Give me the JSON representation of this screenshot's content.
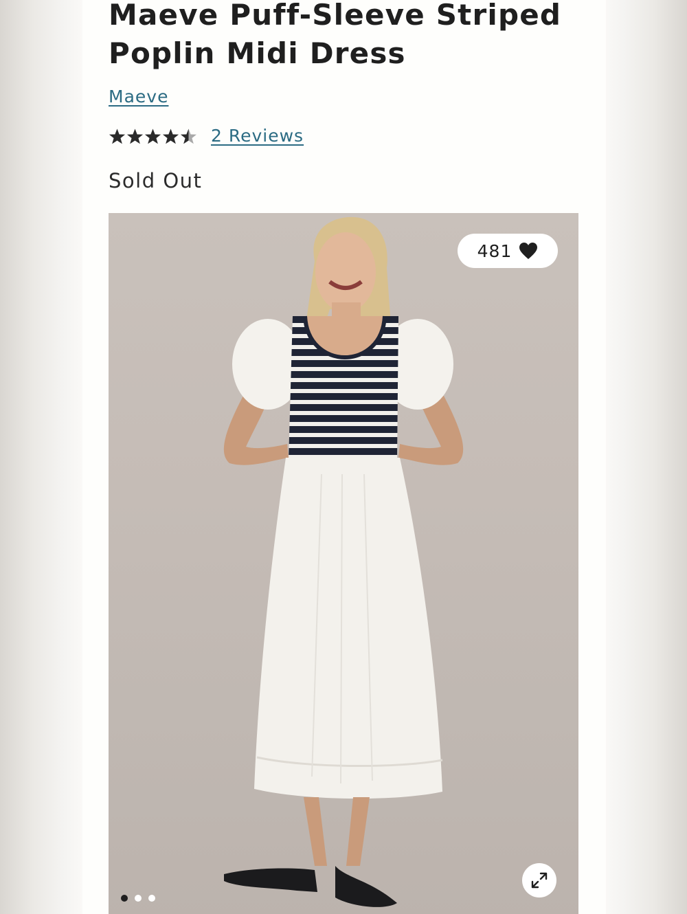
{
  "product": {
    "title": "Maeve Puff-Sleeve Striped Poplin Midi Dress",
    "brand": "Maeve",
    "rating": 4.5,
    "rating_max": 5,
    "reviews_label": "2 Reviews",
    "stock_status": "Sold Out"
  },
  "gallery": {
    "wishlist_count": "481",
    "image_count": 3,
    "active_index": 0
  },
  "icons": {
    "star": "star-icon",
    "heart": "heart-icon",
    "expand": "expand-icon"
  },
  "colors": {
    "link": "#2b6b83",
    "text": "#1f1f1f",
    "background": "#fefefc"
  }
}
